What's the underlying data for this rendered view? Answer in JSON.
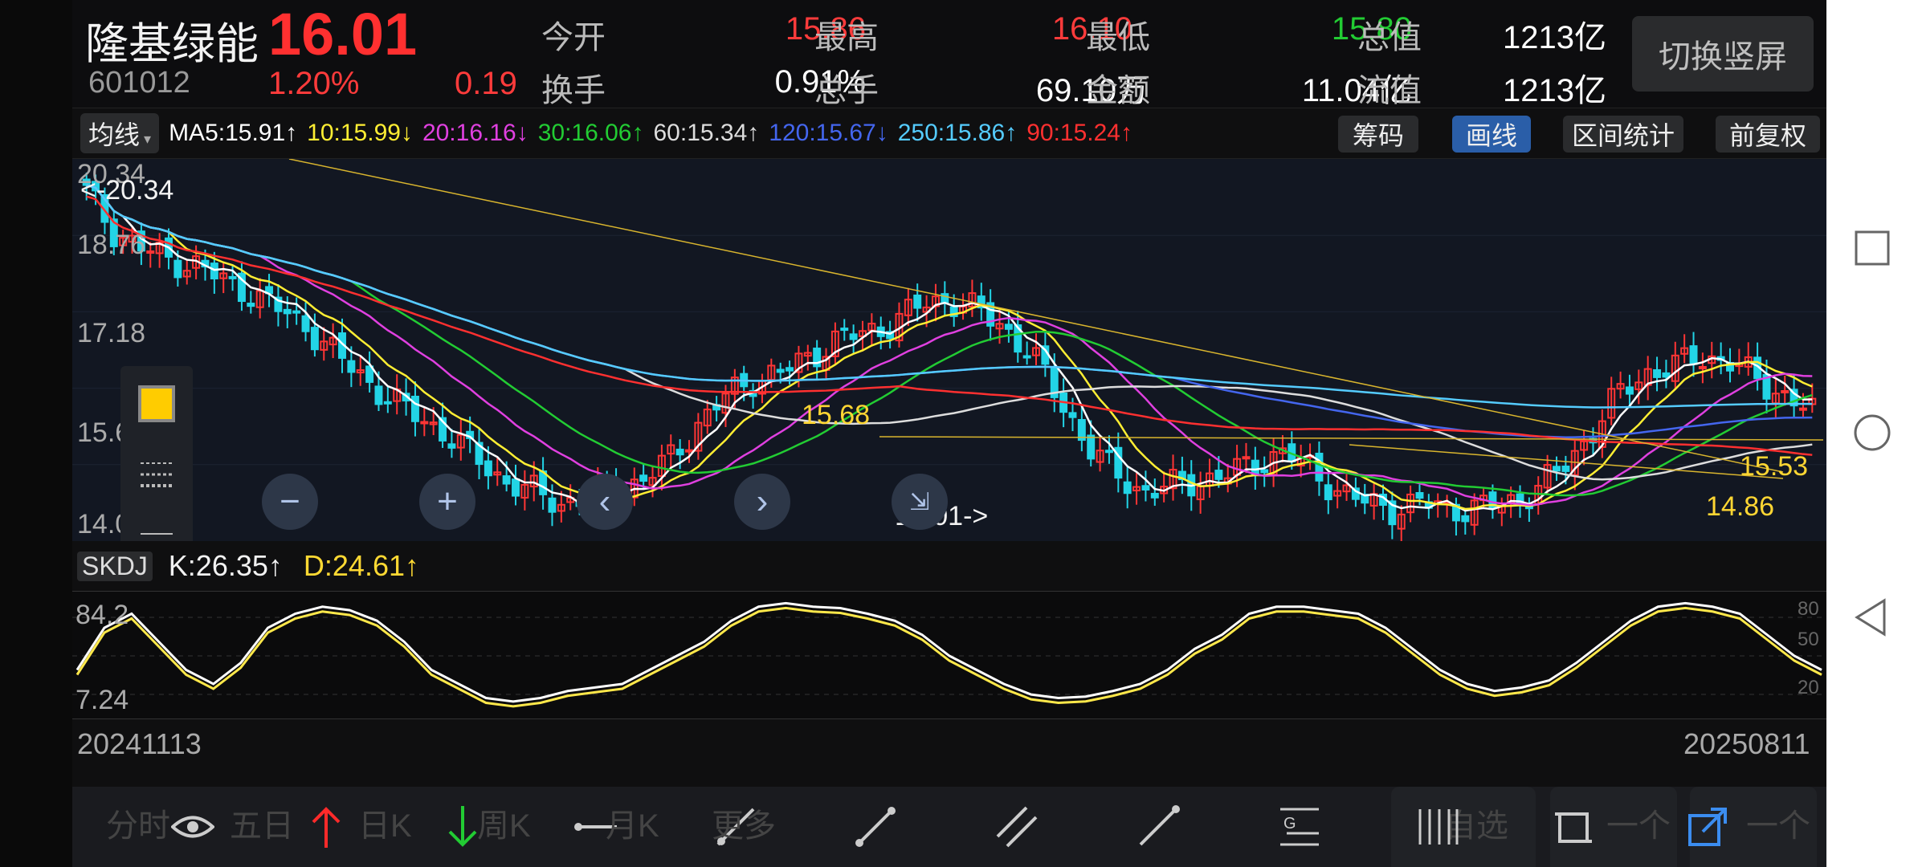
{
  "header": {
    "stock_name": "隆基绿能",
    "price": "16.01",
    "code": "601012",
    "change_pct": "1.20%",
    "change": "0.19",
    "switch_portrait": "切换竖屏",
    "quotes": [
      {
        "label": "今开",
        "value": "15.86",
        "color": "#ff3b3b"
      },
      {
        "label": "最高",
        "value": "16.10",
        "color": "#ff3b3b"
      },
      {
        "label": "最低",
        "value": "15.80",
        "color": "#22cc33"
      },
      {
        "label": "总值",
        "value": "1213亿",
        "color": "#ffffff"
      },
      {
        "label": "换手",
        "value": "0.91%",
        "color": "#ffffff"
      },
      {
        "label": "总手",
        "value": "69.10万",
        "color": "#ffffff"
      },
      {
        "label": "金额",
        "value": "11.04亿",
        "color": "#ffffff"
      },
      {
        "label": "流值",
        "value": "1213亿",
        "color": "#ffffff"
      }
    ]
  },
  "ma_bar": {
    "selector": "均线",
    "items": [
      {
        "text": "MA5:15.91↑",
        "color": "#ffffff"
      },
      {
        "text": "10:15.99↓",
        "color": "#ffee33"
      },
      {
        "text": "20:16.16↓",
        "color": "#e040e0"
      },
      {
        "text": "30:16.06↑",
        "color": "#22cc33"
      },
      {
        "text": "60:15.34↑",
        "color": "#dddddd"
      },
      {
        "text": "120:15.67↓",
        "color": "#4466ee"
      },
      {
        "text": "250:15.86↑",
        "color": "#55ccff"
      },
      {
        "text": "90:15.24↑",
        "color": "#ff3030"
      }
    ],
    "tools": {
      "chips": "筹码",
      "draw": "画线",
      "range": "区间统计",
      "adjust": "前复权"
    }
  },
  "main_chart": {
    "axis": [
      "20.34",
      "18.76",
      "17.18",
      "15.60",
      "14.01"
    ],
    "max_tag": "<-20.34",
    "min_tag": "14.01->",
    "level_1568": "15.68",
    "level_1553": "15.53",
    "level_1486": "14.86"
  },
  "kdj": {
    "name": "SKDJ",
    "k": "K:26.35↑",
    "d": "D:24.61↑",
    "axis_left": [
      "84.2",
      "7.24"
    ],
    "axis_right": [
      "80",
      "50",
      "20"
    ]
  },
  "dates": {
    "start": "20241113",
    "end": "20250811"
  },
  "bottom_bar": {
    "periods": [
      "分时",
      "五日",
      "日K",
      "周K",
      "月K",
      "更多"
    ],
    "right_tabs": [
      "自选",
      "一个",
      "一个"
    ]
  },
  "chart_data": {
    "type": "candlestick",
    "ylim": [
      14.01,
      20.34
    ],
    "x_range": [
      "20241113",
      "20250811"
    ],
    "close_profile": [
      19.9,
      19.2,
      18.9,
      18.7,
      18.6,
      18.3,
      18.1,
      17.8,
      17.5,
      17.0,
      16.6,
      16.2,
      15.9,
      15.6,
      15.2,
      14.8,
      14.6,
      14.4,
      14.5,
      14.6,
      14.8,
      15.2,
      15.8,
      16.3,
      16.6,
      16.7,
      17.0,
      17.3,
      17.4,
      17.6,
      17.9,
      18.0,
      17.8,
      17.5,
      17.0,
      16.2,
      15.4,
      14.9,
      14.6,
      14.7,
      14.8,
      14.9,
      15.1,
      15.3,
      15.0,
      14.6,
      14.4,
      14.3,
      14.4,
      14.3,
      14.3,
      14.4,
      14.6,
      15.0,
      15.6,
      16.3,
      16.7,
      16.8,
      17.0,
      16.9,
      16.6,
      16.3,
      16.0
    ]
  }
}
